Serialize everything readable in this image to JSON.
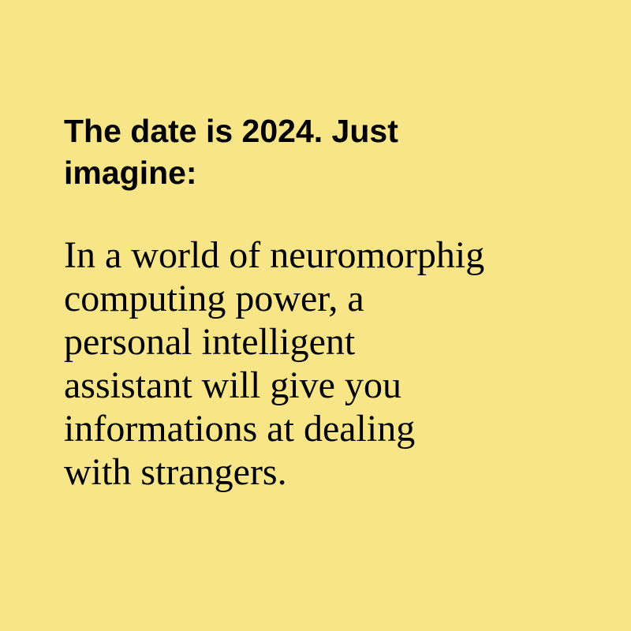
{
  "colors": {
    "background": "#f8e587",
    "text": "#000000"
  },
  "heading": {
    "lines": [
      "The date is 2024. Just",
      "imagine:"
    ]
  },
  "body": {
    "lines": [
      "In a world of neuromorphig",
      "computing power, a",
      "personal intelligent",
      "assistant will give you",
      "informations at dealing",
      "with strangers."
    ]
  }
}
